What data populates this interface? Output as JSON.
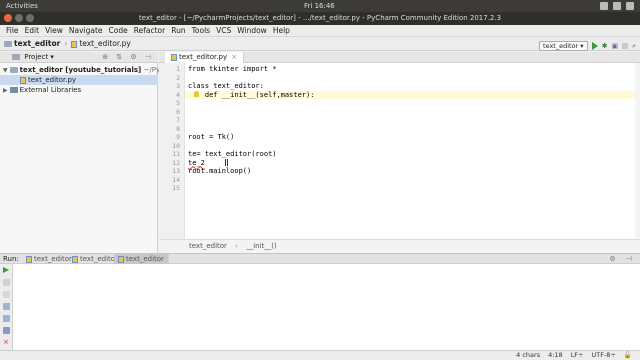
{
  "system": {
    "activities": "Activities",
    "clock": "Fri 16:46"
  },
  "window": {
    "title": "text_editor - [~/PycharmProjects/text_editor] - .../text_editor.py - PyCharm Community Edition 2017.2.3",
    "app_name": "PyCharm Community Edition"
  },
  "menu": [
    "File",
    "Edit",
    "View",
    "Navigate",
    "Code",
    "Refactor",
    "Run",
    "Tools",
    "VCS",
    "Window",
    "Help"
  ],
  "nav": {
    "crumb1": "text_editor",
    "crumb2": "text_editor.py",
    "run_config": "text_editor"
  },
  "project": {
    "header": "Project",
    "root": "text_editor [youtube_tutorials]",
    "root_path": "~/Pycharm",
    "file": "text_editor.py",
    "libs": "External Libraries"
  },
  "editor": {
    "tab": "text_editor.py",
    "lines": [
      {
        "n": "1",
        "text": "from tkinter import *"
      },
      {
        "n": "2",
        "text": ""
      },
      {
        "n": "3",
        "text": "class text_editor:"
      },
      {
        "n": "4",
        "text": "    def __init__(self,master):"
      },
      {
        "n": "5",
        "text": ""
      },
      {
        "n": "6",
        "text": ""
      },
      {
        "n": "7",
        "text": ""
      },
      {
        "n": "8",
        "text": ""
      },
      {
        "n": "9",
        "text": "root = Tk()"
      },
      {
        "n": "10",
        "text": ""
      },
      {
        "n": "11",
        "text": "te= text_editor(root)"
      },
      {
        "n": "12",
        "text": "te_2"
      },
      {
        "n": "13",
        "text": "root.mainloop()"
      },
      {
        "n": "14",
        "text": ""
      },
      {
        "n": "15",
        "text": ""
      }
    ],
    "breadcrumb1": "text_editor",
    "breadcrumb2": "__init__()"
  },
  "run": {
    "label": "Run:",
    "tabs": [
      "text_editor",
      "text_editor",
      "text_editor"
    ]
  },
  "status": {
    "chars": "4 chars",
    "position": "4:18",
    "line_sep": "LF÷",
    "encoding": "UTF-8÷"
  }
}
